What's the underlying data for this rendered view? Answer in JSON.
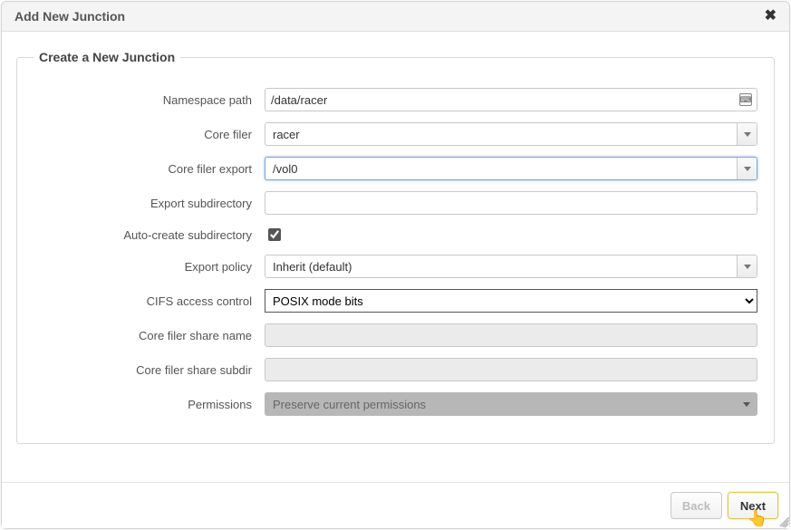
{
  "dialog": {
    "title": "Add New Junction"
  },
  "fieldset": {
    "legend": "Create a New Junction"
  },
  "labels": {
    "namespace_path": "Namespace path",
    "core_filer": "Core filer",
    "core_filer_export": "Core filer export",
    "export_subdir": "Export subdirectory",
    "auto_create": "Auto-create subdirectory",
    "export_policy": "Export policy",
    "cifs_access": "CIFS access control",
    "cf_share_name": "Core filer share name",
    "cf_share_subdir": "Core filer share subdir",
    "permissions": "Permissions"
  },
  "values": {
    "namespace_path": "/data/racer",
    "core_filer": "racer",
    "core_filer_export": "/vol0",
    "export_subdir": "",
    "auto_create": true,
    "export_policy": "Inherit (default)",
    "cifs_access": "POSIX mode bits",
    "cf_share_name": "",
    "cf_share_subdir": "",
    "permissions": "Preserve current permissions"
  },
  "buttons": {
    "back": "Back",
    "next": "Next"
  }
}
